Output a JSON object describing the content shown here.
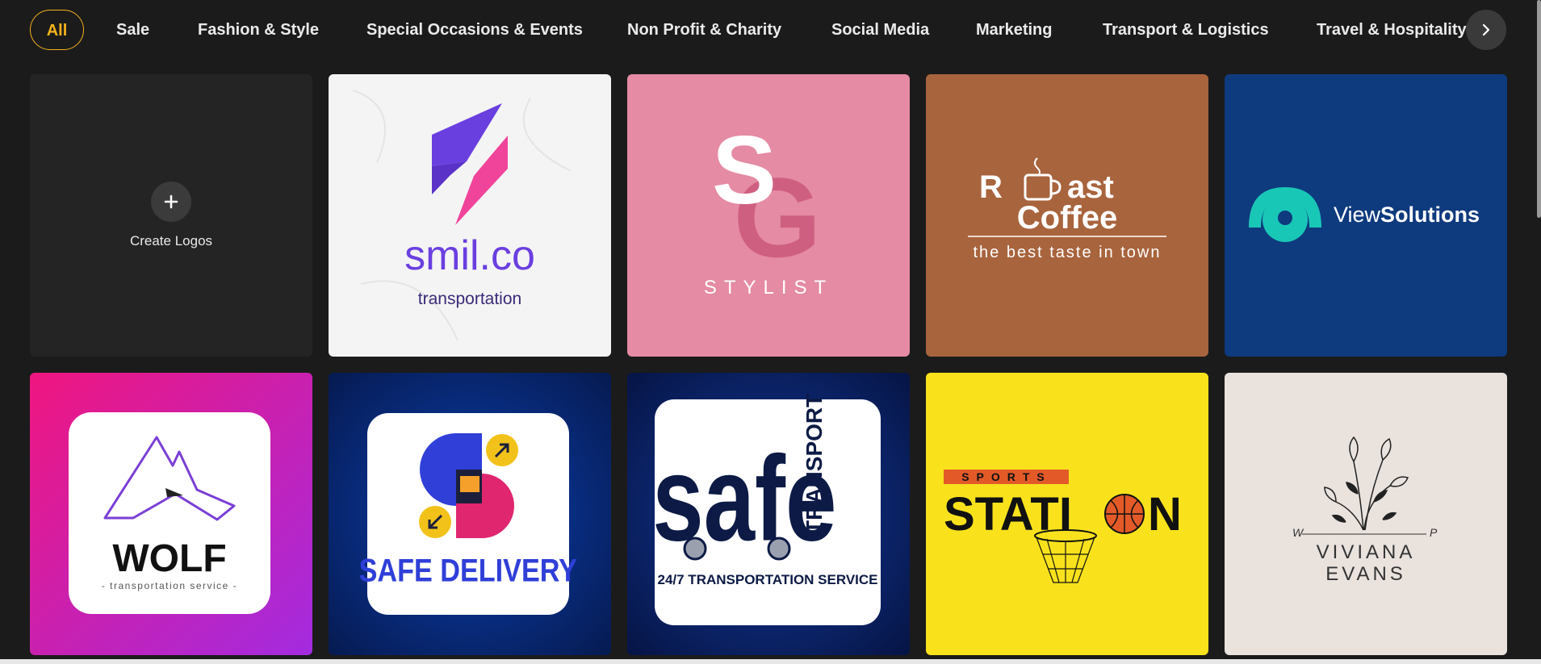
{
  "categories": {
    "tabs": [
      {
        "label": "All",
        "active": true
      },
      {
        "label": "Sale"
      },
      {
        "label": "Fashion & Style"
      },
      {
        "label": "Special Occasions & Events"
      },
      {
        "label": "Non Profit & Charity"
      },
      {
        "label": "Social Media"
      },
      {
        "label": "Marketing"
      },
      {
        "label": "Transport & Logistics"
      },
      {
        "label": "Travel & Hospitality"
      }
    ],
    "next_icon": "chevron-right-icon"
  },
  "create_card": {
    "label": "Create Logos",
    "icon": "plus-icon"
  },
  "logos": {
    "smil": {
      "name": "smil.co",
      "tagline": "transportation"
    },
    "stylist": {
      "letters1": "S",
      "letters2": "G",
      "tagline": "STYLIST"
    },
    "roast": {
      "line1a": "R",
      "line1b": "ast",
      "line2": "Coffee",
      "tagline": "the best taste in town"
    },
    "view": {
      "name_light": "View",
      "name_bold": "Solutions"
    },
    "wolf": {
      "name": "WOLF",
      "tagline": "- transportation service -"
    },
    "safe_delivery": {
      "name": "SAFE DELIVERY"
    },
    "safe_transport": {
      "name": "safe",
      "vertical": "TRANSPORT",
      "tagline": "24/7 TRANSPORTATION SERVICE"
    },
    "sports": {
      "badge": "SPORTS",
      "name_a": "STATI",
      "name_b": "N"
    },
    "viviana": {
      "line1": "VIVIANA",
      "line2": "EVANS",
      "left_initial": "W",
      "right_initial": "P"
    }
  },
  "colors": {
    "accent": "#f3b21b",
    "background": "#1b1b1b"
  }
}
